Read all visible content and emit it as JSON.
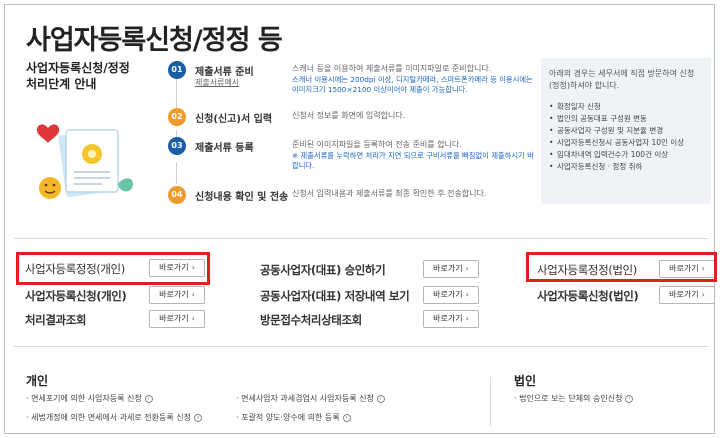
{
  "page": {
    "title": "사업자등록신청/정정 등",
    "guide_title_line1": "사업자등록신청/정정",
    "guide_title_line2": "처리단계 안내"
  },
  "steps": [
    {
      "num": "01",
      "name": "제출서류 준비",
      "sub": "제출서류예시",
      "desc": "스캐너 등을 이용하여 제출서류를 이미지파일로 준비합니다.",
      "note": "스캐너 이용시에는 200dpi 이상, 디지털카메라, 스마트폰카메라 등 이용시에는 이미지크기 1500×2100 이상이어야 제출이 가능합니다.",
      "color": "#1a5ea8"
    },
    {
      "num": "02",
      "name": "신청(신고)서 입력",
      "desc": "신청서 정보를 화면에 입력합니다.",
      "color": "#ee9a2c"
    },
    {
      "num": "03",
      "name": "제출서류 등록",
      "desc": "준비된 이미지파일을 등록하여 전송 준비를 합니다.",
      "note": "※ 제출서류를 누락하면 처리가 지연 되므로 구비서류를 빠짐없이 제출하시기 바랍니다.",
      "color": "#1a5ea8"
    },
    {
      "num": "04",
      "name": "신청내용 확인 및 전송",
      "desc": "신청서 입력내용과 제출서류를 최종 확인한 후 전송합니다.",
      "color": "#ee9a2c"
    }
  ],
  "notice": {
    "head": "아래의 경우는 세무서에 직접 방문하여 신청(정정)하셔야 합니다.",
    "items": [
      "확정일자 신청",
      "법인의 공동대표 구성원 변동",
      "공동사업자 구성원 및 지분율 변경",
      "사업자등록신청시 공동사업자 10인 이상",
      "임대차내역 입력건수가 100건 이상",
      "사업자등록신청 · 정정 취하"
    ]
  },
  "links": {
    "button_label": "바로가기",
    "col1": [
      "사업자등록정정(개인)",
      "사업자등록신청(개인)",
      "처리결과조회"
    ],
    "col2": [
      "공동사업자(대표) 승인하기",
      "공동사업자(대표) 저장내역 보기",
      "방문접수처리상태조회"
    ],
    "col3": [
      "사업자등록정정(법인)",
      "사업자등록신청(법인)"
    ]
  },
  "bottom": {
    "personal_title": "개인",
    "personal_items": [
      "면세포기에 의한 사업자등록 신청",
      "면세사업자 과세겸업시 사업자등록 신청",
      "세법개정에 의한 면세에서 과세로 전환등록 신청",
      "포괄적 양도·양수에 의한 등록"
    ],
    "corp_title": "법인",
    "corp_items": [
      "법인으로 보는 단체의 승인신청"
    ]
  },
  "colors": {
    "highlight": "#e02020",
    "step_blue": "#1a5ea8",
    "step_orange": "#ee9a2c",
    "note_blue": "#1a67c1",
    "notice_bg": "#eff3f8"
  }
}
